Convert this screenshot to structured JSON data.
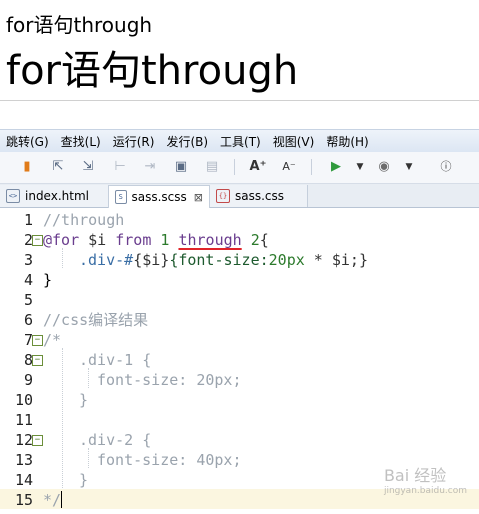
{
  "preview": {
    "small_text": "for语句through",
    "big_text": "for语句through"
  },
  "menu": {
    "items": [
      "跳转(G)",
      "查找(L)",
      "运行(R)",
      "发行(B)",
      "工具(T)",
      "视图(V)",
      "帮助(H)"
    ]
  },
  "toolbar": {
    "icons": [
      "bookmark-icon",
      "export-icon",
      "export2-icon",
      "cut-icon",
      "step-icon",
      "window-icon",
      "window2-icon",
      "font-increase-icon",
      "font-decrease-icon",
      "run-icon",
      "dropdown-icon",
      "browser-icon",
      "dropdown-icon",
      "info-icon"
    ]
  },
  "tabs": [
    {
      "label": "index.html",
      "icon": "html-file-icon",
      "active": false
    },
    {
      "label": "sass.scss",
      "icon": "scss-file-icon",
      "active": true,
      "close": "⊠"
    },
    {
      "label": "sass.css",
      "icon": "css-file-icon",
      "active": false
    }
  ],
  "editor": {
    "line_numbers": [
      "1",
      "2",
      "3",
      "4",
      "5",
      "6",
      "7",
      "8",
      "9",
      "10",
      "11",
      "12",
      "13",
      "14",
      "15"
    ],
    "lines": {
      "l1": "//through",
      "l2_a": "@for",
      "l2_b": " $i ",
      "l2_c": "from",
      "l2_d": " 1 ",
      "l2_e": "through",
      "l2_f": " 2",
      "l2_g": "{",
      "l3_a": ".div-#",
      "l3_b": "{$i}",
      "l3_c": "{font-size:",
      "l3_d": "20px",
      "l3_e": " * $i;}",
      "l4": "}",
      "l6": "//css编译结果",
      "l7": "/*",
      "l8": ".div-1 {",
      "l9": "font-size: 20px;",
      "l10": "}",
      "l12": ".div-2 {",
      "l13": "font-size: 40px;",
      "l14": "}",
      "l15": "*/"
    }
  },
  "watermark": {
    "text": "Bai 经验",
    "sub": "jingyan.baidu.com"
  }
}
